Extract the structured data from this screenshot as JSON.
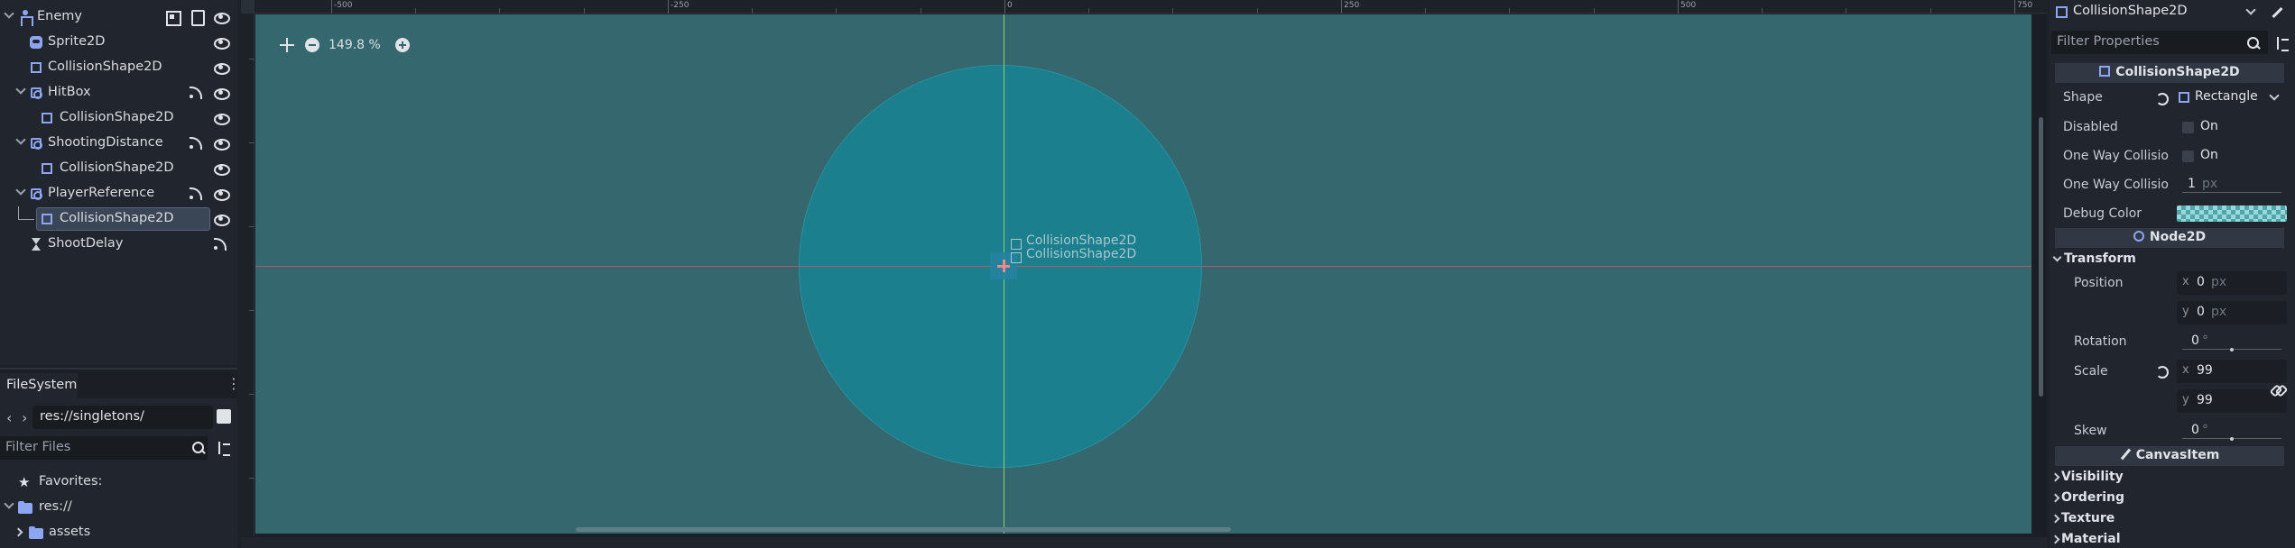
{
  "scene_tree": {
    "nodes": [
      {
        "label": "Enemy"
      },
      {
        "label": "Sprite2D"
      },
      {
        "label": "CollisionShape2D"
      },
      {
        "label": "HitBox"
      },
      {
        "label": "CollisionShape2D"
      },
      {
        "label": "ShootingDistance"
      },
      {
        "label": "CollisionShape2D"
      },
      {
        "label": "PlayerReference"
      },
      {
        "label": "CollisionShape2D"
      },
      {
        "label": "ShootDelay"
      }
    ]
  },
  "filesystem": {
    "tab_label": "FileSystem",
    "path": "res://singletons/",
    "filter_placeholder": "Filter Files",
    "favorites_label": "Favorites:",
    "root_label": "res://",
    "folder_label": "assets"
  },
  "viewport": {
    "zoom_level": "149.8 %",
    "ruler_labels": [
      "-500",
      "-250",
      "0",
      "250",
      "500",
      "750"
    ],
    "node_labels": [
      "CollisionShape2D",
      "CollisionShape2D"
    ],
    "colors": {
      "canvas": "#35676e",
      "shape": "#1b7f8e",
      "x_axis": "#b05a6a",
      "y_axis": "#8dd06a"
    }
  },
  "inspector": {
    "object_name": "CollisionShape2D",
    "filter_placeholder": "Filter Properties",
    "section_collision": "CollisionShape2D",
    "shape_label": "Shape",
    "shape_value": "Rectangle",
    "disabled_label": "Disabled",
    "disabled_value": "On",
    "oneway_label": "One Way Collisio",
    "oneway_value": "On",
    "oneway_margin_label": "One Way Collisio",
    "oneway_margin_value": "1",
    "oneway_margin_unit": "px",
    "debug_color_label": "Debug Color",
    "section_node2d": "Node2D",
    "transform_label": "Transform",
    "position_label": "Position",
    "position_x": "0",
    "position_y": "0",
    "position_unit": "px",
    "axis_x": "x",
    "axis_y": "y",
    "rotation_label": "Rotation",
    "rotation_value": "0",
    "rotation_unit": "°",
    "scale_label": "Scale",
    "scale_x": "99",
    "scale_y": "99",
    "skew_label": "Skew",
    "skew_value": "0",
    "skew_unit": "°",
    "section_canvas": "CanvasItem",
    "groups": [
      "Visibility",
      "Ordering",
      "Texture",
      "Material"
    ]
  }
}
